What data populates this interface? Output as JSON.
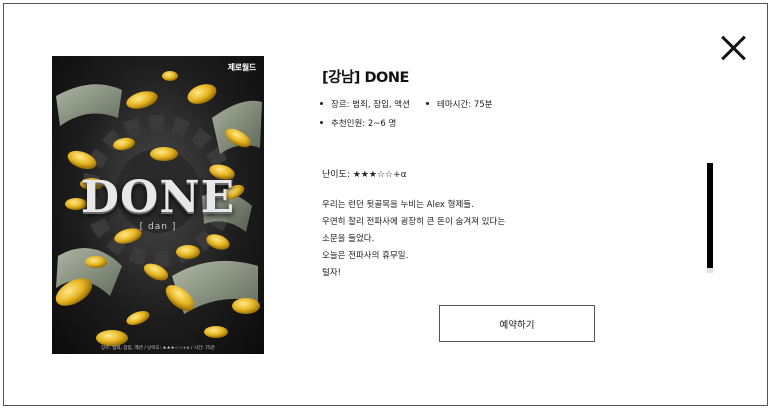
{
  "poster": {
    "brand": "제로월드",
    "title": "DONE",
    "subtitle": "[ dan ]",
    "footer": "장르: 범죄, 잠입, 액션 / 난이도: ★★★☆☆+α / 시간: 75분"
  },
  "detail": {
    "title": "[강남] DONE",
    "genre": "장르: 범죄, 잠입, 액션",
    "time": "테마시간: 75분",
    "players": "추천인원: 2~6 명",
    "difficulty": "난이도: ★★★☆☆+α",
    "description": "우리는 런던 뒷골목을 누비는 Alex 형제들.\n우연히 찰리 전파사에 굉장히 큰 돈이 숨겨져 있다는\n소문을 들었다.\n오늘은 전파사의 휴무일.\n털자!"
  },
  "actions": {
    "reserve_label": "예약하기"
  }
}
